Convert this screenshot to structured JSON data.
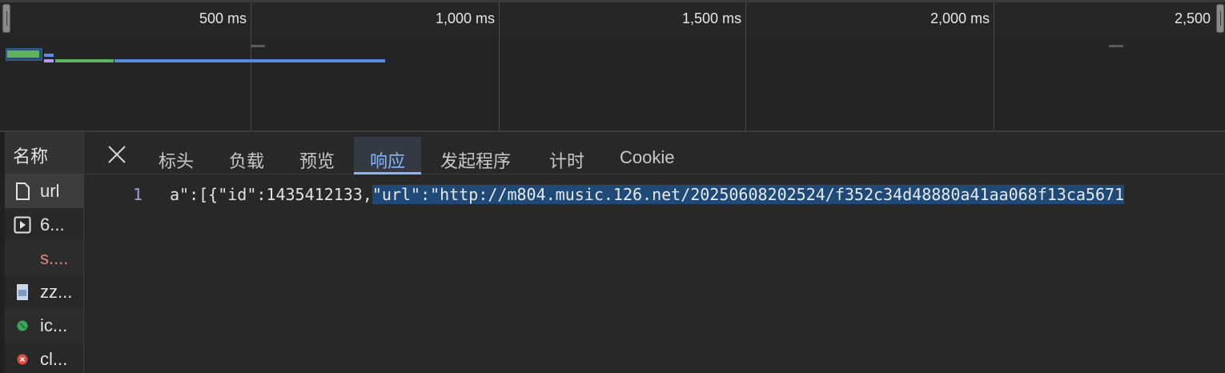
{
  "overview": {
    "ticks": [
      "500 ms",
      "1,000 ms",
      "1,500 ms",
      "2,000 ms",
      "2,500"
    ]
  },
  "colors": {
    "waiting": "#5fb35f",
    "download": "#5a8be0",
    "queue": "#b49be6",
    "accent": "#8ab4f8",
    "selection": "#1f4a78"
  },
  "name_column": {
    "header": "名称",
    "rows": [
      {
        "icon": "document-icon",
        "name": "url"
      },
      {
        "icon": "media-play-icon",
        "name": "6..."
      },
      {
        "icon": "none",
        "name": "s...."
      },
      {
        "icon": "image-icon",
        "name": "zz..."
      },
      {
        "icon": "green-circle-icon",
        "name": "ic..."
      },
      {
        "icon": "red-circle-icon",
        "name": "cl..."
      }
    ]
  },
  "tabs": {
    "items": [
      "标头",
      "负载",
      "预览",
      "响应",
      "发起程序",
      "计时",
      "Cookie"
    ],
    "active": "响应"
  },
  "response": {
    "line_number": "1",
    "prefix": "a\":[{\"id\":1435412133,",
    "selected_text": "\"url\":\"http://m804.music.126.net/20250608202524/f352c34d48880a41aa068f13ca5671"
  }
}
